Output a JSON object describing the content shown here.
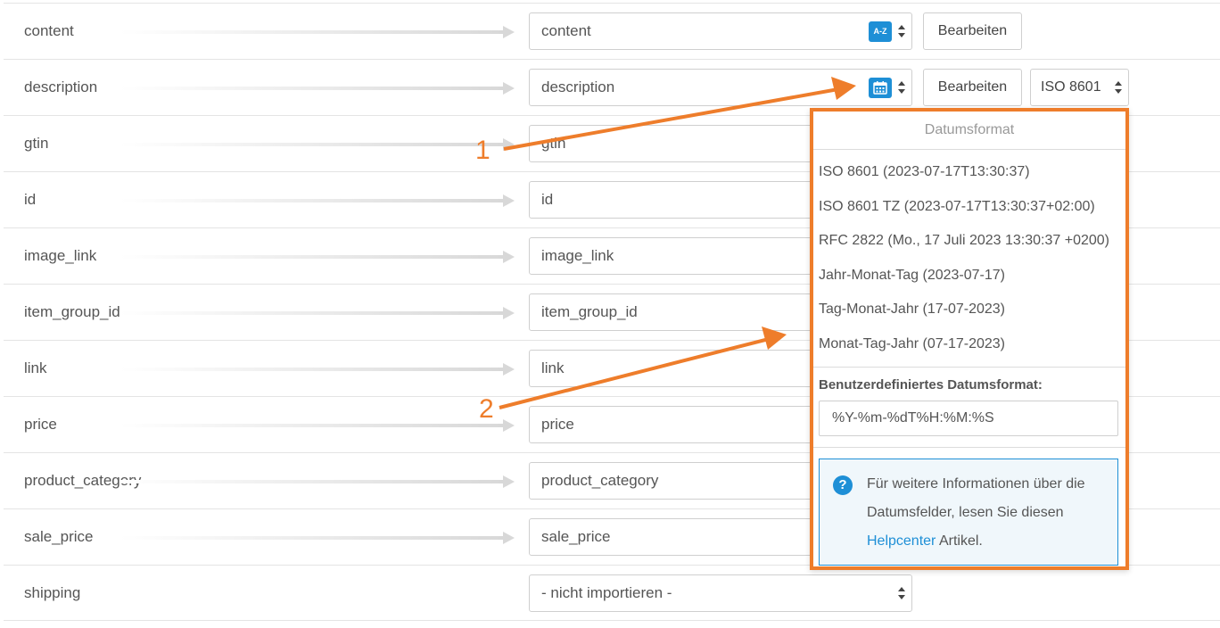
{
  "rows": [
    {
      "label": "content",
      "value": "content",
      "type_icon": "az-icon",
      "edit": "Bearbeiten"
    },
    {
      "label": "description",
      "value": "description",
      "type_icon": "calendar-icon",
      "edit": "Bearbeiten",
      "format": "ISO 8601"
    },
    {
      "label": "gtin",
      "value": "gtin"
    },
    {
      "label": "id",
      "value": "id"
    },
    {
      "label": "image_link",
      "value": "image_link"
    },
    {
      "label": "item_group_id",
      "value": "item_group_id"
    },
    {
      "label": "link",
      "value": "link"
    },
    {
      "label": "price",
      "value": "price"
    },
    {
      "label": "product_category",
      "value": "product_category"
    },
    {
      "label": "sale_price",
      "value": "sale_price"
    },
    {
      "label": "shipping",
      "value": "- nicht importieren -"
    }
  ],
  "badge_az": "A-Z",
  "dropdown": {
    "title": "Datumsformat",
    "options": [
      "ISO 8601 (2023-07-17T13:30:37)",
      "ISO 8601 TZ (2023-07-17T13:30:37+02:00)",
      "RFC 2822 (Mo., 17 Juli 2023 13:30:37 +0200)",
      "Jahr-Monat-Tag (2023-07-17)",
      "Tag-Monat-Jahr (17-07-2023)",
      "Monat-Tag-Jahr (07-17-2023)"
    ],
    "custom_label": "Benutzerdefiniertes Datumsformat:",
    "custom_value": "%Y-%m-%dT%H:%M:%S",
    "info_prefix": "Für weitere Informationen über die Datumsfelder, lesen Sie diesen",
    "info_link": "Helpcenter",
    "info_suffix": "Artikel."
  },
  "annotations": {
    "one": "1",
    "two": "2"
  },
  "colors": {
    "accent": "#ee7d2b",
    "primary": "#1e8fd6"
  }
}
